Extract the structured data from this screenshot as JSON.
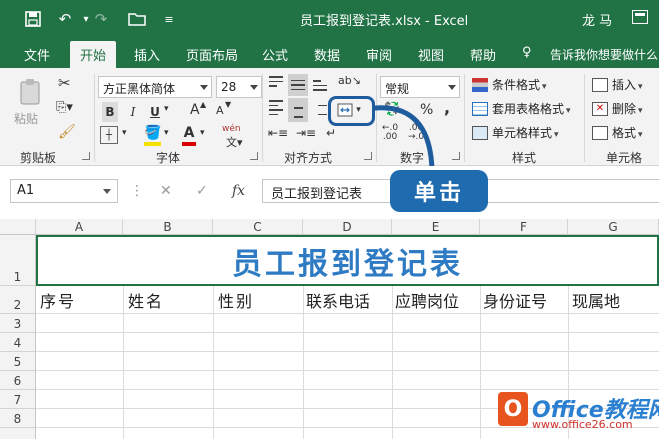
{
  "window": {
    "title": "员工报到登记表.xlsx  -  Excel",
    "user": "龙 马"
  },
  "tabs": [
    {
      "label": "文件"
    },
    {
      "label": "开始"
    },
    {
      "label": "插入"
    },
    {
      "label": "页面布局"
    },
    {
      "label": "公式"
    },
    {
      "label": "数据"
    },
    {
      "label": "审阅"
    },
    {
      "label": "视图"
    },
    {
      "label": "帮助"
    },
    {
      "label": "告诉我你想要做什么"
    }
  ],
  "ribbon": {
    "clipboard": {
      "paste": "粘贴",
      "label": "剪贴板"
    },
    "font": {
      "name": "方正黑体简体",
      "size": "28",
      "bold": "B",
      "italic": "I",
      "underline": "U",
      "grow": "A",
      "shrink": "A",
      "wen": "wén",
      "label": "字体"
    },
    "alignment": {
      "label": "对齐方式"
    },
    "number": {
      "format": "常规",
      "percent": "%",
      "comma": ",",
      "inc": "←.0\n.00",
      "dec": ".00\n→.0",
      "label": "数字"
    },
    "styles": {
      "conditional": "条件格式",
      "table": "套用表格格式",
      "cell": "单元格样式",
      "label": "样式"
    },
    "cells": {
      "insert": "插入",
      "delete": "删除",
      "format": "格式",
      "label": "单元格"
    }
  },
  "formula_bar": {
    "name_box": "A1",
    "fx": "fx",
    "value": "员工报到登记表"
  },
  "sheet": {
    "columns": [
      "A",
      "B",
      "C",
      "D",
      "E",
      "F",
      "G"
    ],
    "rows": [
      "1",
      "2",
      "3",
      "4",
      "5",
      "6",
      "7",
      "8"
    ],
    "title": "员工报到登记表",
    "headers": [
      "序号",
      "姓名",
      "性别",
      "联系电话",
      "应聘岗位",
      "身份证号",
      "现属地"
    ]
  },
  "callout": {
    "text": "单击"
  },
  "watermark": {
    "brand": "Office教程网",
    "url": "www.office26.com"
  },
  "colors": {
    "accent": "#217346",
    "title_text": "#2e7bc4",
    "callout": "#1e6bb0"
  }
}
